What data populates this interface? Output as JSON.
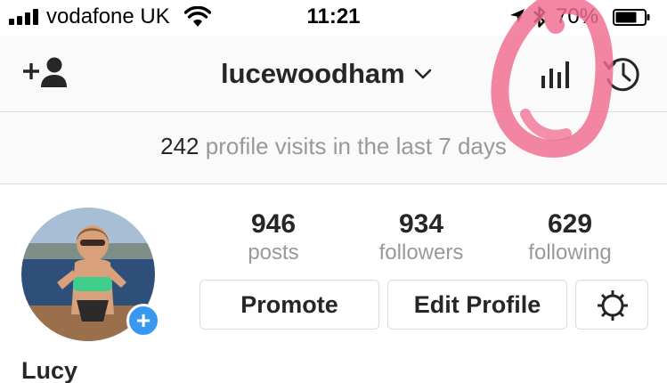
{
  "status_bar": {
    "carrier": "vodafone UK",
    "time": "11:21",
    "battery_percent": "70%",
    "signal_icon": "signal-bars-icon",
    "wifi_icon": "wifi-icon",
    "location_icon": "location-arrow-icon",
    "bluetooth_icon": "bluetooth-icon",
    "battery_icon": "battery-icon"
  },
  "header": {
    "username": "lucewoodham",
    "add_user_icon": "add-user-icon",
    "insights_icon": "insights-bar-chart-icon",
    "archive_icon": "archive-history-icon"
  },
  "visits": {
    "count": "242",
    "label": "profile visits in the last 7 days"
  },
  "profile": {
    "name": "Lucy",
    "stats": [
      {
        "value": "946",
        "label": "posts"
      },
      {
        "value": "934",
        "label": "followers"
      },
      {
        "value": "629",
        "label": "following"
      }
    ],
    "buttons": {
      "promote": "Promote",
      "edit_profile": "Edit Profile"
    },
    "add_story_symbol": "+"
  },
  "colors": {
    "accent_blue": "#3897f0",
    "secondary_text": "#999999",
    "border": "#dbdbdb",
    "annotation_pink": "#f06b8d"
  }
}
